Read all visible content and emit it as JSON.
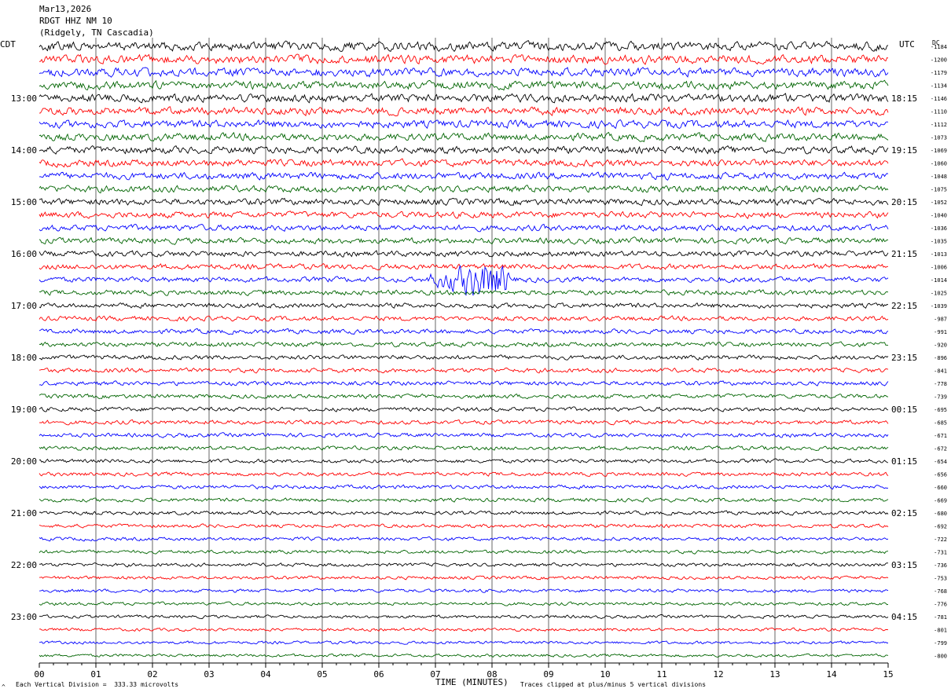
{
  "header": {
    "date": "Mar13,2026",
    "station": "RDGT HHZ NM 10",
    "location": "(Ridgely, TN Cascadia)"
  },
  "left_tz": "CDT",
  "right_tz": "UTC",
  "dc_label": "DC",
  "footer": {
    "mark": "^",
    "vertical_division": "Each Vertical Division =  333.33 microvolts",
    "clipping": "Traces clipped at plus/minus 5 vertical divisions"
  },
  "colors": {
    "trace_cycle": [
      "#000000",
      "#ff0000",
      "#0000ff",
      "#006400"
    ],
    "gridline": "#000000"
  },
  "chart_data": {
    "type": "line",
    "xlabel": "TIME (MINUTES)",
    "xlim": [
      0,
      15
    ],
    "x_ticks": [
      "00",
      "01",
      "02",
      "03",
      "04",
      "05",
      "06",
      "07",
      "08",
      "09",
      "10",
      "11",
      "12",
      "13",
      "14",
      "15"
    ],
    "left_hour_labels": [
      "13:00",
      "14:00",
      "15:00",
      "16:00",
      "17:00",
      "18:00",
      "19:00",
      "20:00",
      "21:00",
      "22:00",
      "23:00"
    ],
    "right_hour_labels": [
      "18:15",
      "19:15",
      "20:15",
      "21:15",
      "22:15",
      "23:15",
      "00:15",
      "01:15",
      "02:15",
      "03:15",
      "04:15"
    ],
    "hour_label_start_row": 4,
    "rows_per_hour": 4,
    "dc_offsets": [
      -1184,
      -1200,
      -1179,
      -1134,
      -1146,
      -1110,
      -1112,
      -1073,
      -1069,
      -1060,
      -1048,
      -1075,
      -1052,
      -1040,
      -1036,
      -1035,
      -1013,
      -1006,
      -1014,
      -1025,
      -1039,
      -987,
      -991,
      -920,
      -896,
      -841,
      -778,
      -739,
      -695,
      -685,
      -671,
      -672,
      -654,
      -656,
      -660,
      -669,
      -680,
      -692,
      -722,
      -731,
      -736,
      -753,
      -768,
      -776,
      -781,
      -801,
      -799,
      -800
    ],
    "event": {
      "row": 18,
      "start_minute": 6.8,
      "peak_minute": 7.9,
      "end_minute": 8.3
    },
    "grid": true
  }
}
